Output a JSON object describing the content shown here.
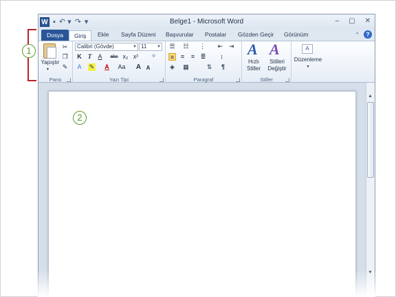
{
  "window": {
    "title": "Belge1 - Microsoft Word",
    "controls": [
      "–",
      "▢",
      "✕"
    ]
  },
  "qat": {
    "app_icon": "W",
    "items": [
      "save-icon",
      "undo-icon",
      "redo-icon",
      "customize-icon"
    ]
  },
  "tabs": {
    "file": "Dosya",
    "items": [
      "Giriş",
      "Ekle",
      "Sayfa Düzeni",
      "Başvurular",
      "Postalar",
      "Gözden Geçir",
      "Görünüm"
    ],
    "help": "?"
  },
  "ribbon": {
    "clipboard": {
      "label": "Pano",
      "paste": "Yapıştır"
    },
    "font": {
      "label": "Yazı Tipi",
      "font_name": "Calibri (Gövde)",
      "font_size": "11",
      "bold": "K",
      "italic": "T",
      "underline": "A",
      "strike": "abc",
      "sub": "x₂",
      "sup": "x²",
      "grow": "A",
      "shrink": "A",
      "case": "Aa",
      "color": "A"
    },
    "paragraph": {
      "label": "Paragraf",
      "pilcrow": "¶"
    },
    "styles": {
      "label": "Stiller",
      "quick": "Hızlı Stiller",
      "change": "Stilleri Değiştir"
    },
    "editing": {
      "label": "",
      "button": "Düzenleme"
    }
  },
  "callouts": {
    "one": "1",
    "two": "2"
  }
}
